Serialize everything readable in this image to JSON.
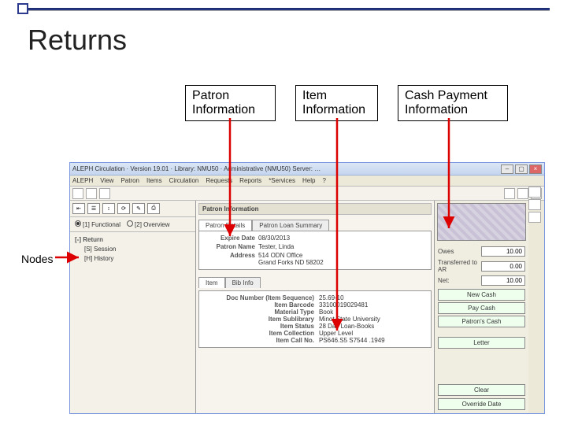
{
  "slide": {
    "title": "Returns",
    "callout_patron": "Patron Information",
    "callout_item": "Item Information",
    "callout_cash": "Cash Payment Information",
    "nodes_label": "Nodes"
  },
  "window": {
    "title": "ALEPH Circulation · Version 19.01 · Library: NMU50 · Administrative (NMU50) Server: …",
    "menu": [
      "ALEPH",
      "View",
      "Patron",
      "Items",
      "Circulation",
      "Requests",
      "Reports",
      "*Services",
      "Help",
      "?"
    ],
    "radio1": "[1] Functional",
    "radio2": "[2] Overview",
    "tree_root": "[-] Return",
    "tree_s": "[S] Session",
    "tree_h": "[H] History",
    "section_patron": "Patron Information",
    "tab_details": "Patron Details",
    "tab_summary": "Patron Loan Summary",
    "patron": {
      "expire_lab": "Expire Date",
      "expire_val": "08/30/2013",
      "name_lab": "Patron Name",
      "name_val": "Tester, Linda",
      "addr_lab": "Address",
      "addr_val": "514 ODN Office\nGrand Forks ND 58202"
    },
    "section_item_tab1": "Item",
    "section_item_tab2": "Bib Info",
    "item": {
      "docnum_lab": "Doc Number (Item Sequence)",
      "docnum_val": "25.69-10",
      "barcode_lab": "Item Barcode",
      "barcode_val": "33100019029481",
      "mtype_lab": "Material Type",
      "mtype_val": "Book",
      "sublib_lab": "Item Sublibrary",
      "sublib_val": "Minot State University",
      "status_lab": "Item Status",
      "status_val": "28 Day Loan-Books",
      "coll_lab": "Item Collection",
      "coll_val": "Upper Level",
      "call_lab": "Item Call No.",
      "call_val": "PS646.S5 S7544 .1949"
    },
    "cash": {
      "owes_lab": "Owes",
      "owes_val": "10.00",
      "trans_lab": "Transferred to AR",
      "trans_val": "0.00",
      "net_lab": "Net:",
      "net_val": "10.00"
    },
    "buttons": {
      "new_cash": "New Cash",
      "pay_cash": "Pay Cash",
      "patrons_cash": "Patron's Cash",
      "letter": "Letter",
      "clear": "Clear",
      "override": "Override Date"
    }
  }
}
